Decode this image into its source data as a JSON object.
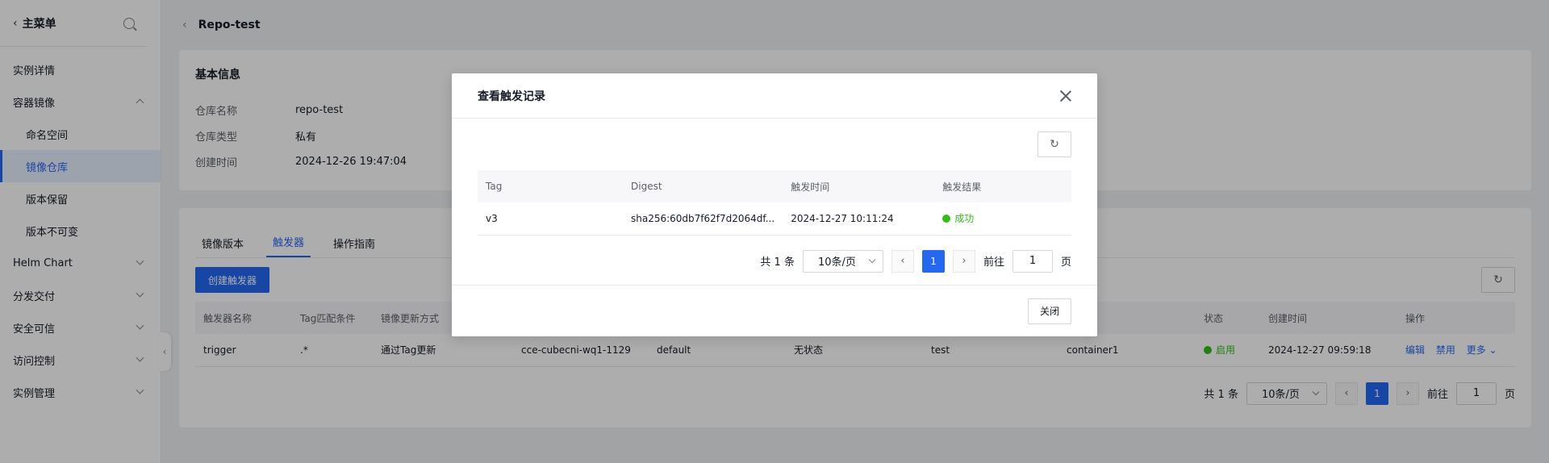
{
  "sidebar": {
    "title": "主菜单",
    "items": [
      {
        "label": "实例详情",
        "level": 1
      },
      {
        "label": "容器镜像",
        "level": 1,
        "expanded": true
      },
      {
        "label": "命名空间",
        "level": 2
      },
      {
        "label": "镜像仓库",
        "level": 2,
        "active": true
      },
      {
        "label": "版本保留",
        "level": 2
      },
      {
        "label": "版本不可变",
        "level": 2
      },
      {
        "label": "Helm Chart",
        "level": 1
      },
      {
        "label": "分发交付",
        "level": 1
      },
      {
        "label": "安全可信",
        "level": 1
      },
      {
        "label": "访问控制",
        "level": 1
      },
      {
        "label": "实例管理",
        "level": 1
      }
    ]
  },
  "header": {
    "title": "Repo-test"
  },
  "info": {
    "title": "基本信息",
    "rows": [
      {
        "key": "仓库名称",
        "value": "repo-test"
      },
      {
        "key": "仓库类型",
        "value": "私有"
      },
      {
        "key": "创建时间",
        "value": "2024-12-26 19:47:04"
      }
    ]
  },
  "tabs": [
    {
      "label": "镜像版本"
    },
    {
      "label": "触发器",
      "active": true
    },
    {
      "label": "操作指南"
    }
  ],
  "toolbar": {
    "create_label": "创建触发器"
  },
  "table": {
    "headers": [
      "触发器名称",
      "Tag匹配条件",
      "镜像更新方式",
      "",
      "",
      "",
      "",
      "",
      "状态",
      "创建时间",
      "操作"
    ],
    "rows": [
      {
        "cells": [
          "trigger",
          ".*",
          "通过Tag更新",
          "cce-cubecni-wq1-1129",
          "default",
          "无状态",
          "test",
          "container1"
        ],
        "status": "启用",
        "created": "2024-12-27 09:59:18",
        "actions": [
          "编辑",
          "禁用",
          "更多"
        ]
      }
    ]
  },
  "pager": {
    "total": "共 1 条",
    "page_size": "10条/页",
    "current": "1",
    "goto_label": "前往",
    "goto_value": "1",
    "page_suffix": "页"
  },
  "modal": {
    "title": "查看触发记录",
    "headers": [
      "Tag",
      "Digest",
      "触发时间",
      "触发结果"
    ],
    "rows": [
      {
        "tag": "v3",
        "digest": "sha256:60db7f62f7d2064df...",
        "time": "2024-12-27 10:11:24",
        "result": "成功"
      }
    ],
    "pager": {
      "total": "共 1 条",
      "page_size": "10条/页",
      "current": "1",
      "goto_label": "前往",
      "goto_value": "1",
      "page_suffix": "页"
    },
    "close_label": "关闭"
  },
  "colors": {
    "accent": "#2468f2",
    "success": "#30bf13"
  }
}
